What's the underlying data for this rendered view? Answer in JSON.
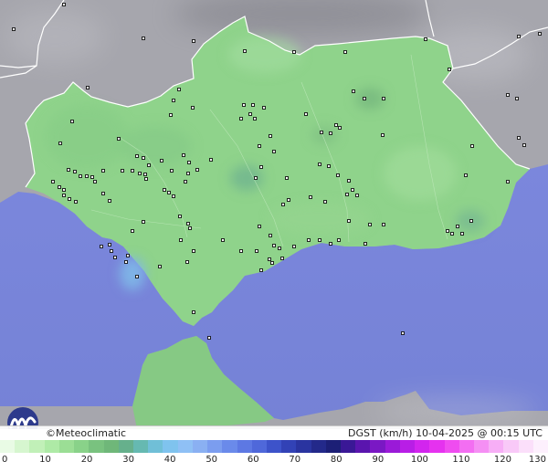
{
  "brand": {
    "text": "©Meteoclimatic"
  },
  "map_caption": {
    "variable": "DGST",
    "unit": "(km/h)",
    "timestamp": "10-04-2025 @ 00:15 UTC"
  },
  "colors": {
    "sea": "#7b87dc",
    "land_foreign": "#a6a6ad",
    "land_andalusia": "#8ed18a",
    "border": "#ffffff",
    "station": "#111111"
  },
  "scale": {
    "labels": [
      "0",
      "10",
      "20",
      "30",
      "40",
      "50",
      "60",
      "70",
      "80",
      "90",
      "100",
      "110",
      "120",
      "130"
    ],
    "colors": [
      "#e9fbe5",
      "#d6f6cf",
      "#c1f0b8",
      "#aeeaa6",
      "#9bde95",
      "#89d289",
      "#79c27f",
      "#6fb779",
      "#66b08c",
      "#66b9b1",
      "#70bfd7",
      "#7fc3ee",
      "#8fc0f5",
      "#8ab0f2",
      "#7b9def",
      "#6a8aea",
      "#5d78e3",
      "#4f68da",
      "#3d53ca",
      "#3242b6",
      "#2a34a0",
      "#23298a",
      "#1c1f76",
      "#3a1896",
      "#5a15ae",
      "#7a18c4",
      "#9a1ad8",
      "#b81ee6",
      "#d225ee",
      "#e532ef",
      "#ef4cf0",
      "#f36ef2",
      "#f58ff4",
      "#f7aef6",
      "#f9c9f8",
      "#fbdffa",
      "#fdf0fd"
    ]
  },
  "stations": [
    [
      70,
      5
    ],
    [
      15,
      32
    ],
    [
      157,
      42
    ],
    [
      212,
      45
    ],
    [
      268,
      56
    ],
    [
      322,
      57
    ],
    [
      378,
      57
    ],
    [
      466,
      43
    ],
    [
      568,
      40
    ],
    [
      591,
      37
    ],
    [
      492,
      76
    ],
    [
      96,
      96
    ],
    [
      196,
      98
    ],
    [
      267,
      115
    ],
    [
      277,
      115
    ],
    [
      289,
      118
    ],
    [
      274,
      125
    ],
    [
      264,
      130
    ],
    [
      279,
      130
    ],
    [
      211,
      118
    ],
    [
      190,
      110
    ],
    [
      187,
      126
    ],
    [
      335,
      125
    ],
    [
      387,
      100
    ],
    [
      399,
      108
    ],
    [
      420,
      108
    ],
    [
      368,
      137
    ],
    [
      372,
      140
    ],
    [
      362,
      146
    ],
    [
      352,
      145
    ],
    [
      419,
      148
    ],
    [
      556,
      104
    ],
    [
      566,
      108
    ],
    [
      568,
      151
    ],
    [
      574,
      159
    ],
    [
      517,
      160
    ],
    [
      79,
      133
    ],
    [
      130,
      152
    ],
    [
      150,
      171
    ],
    [
      157,
      173
    ],
    [
      163,
      181
    ],
    [
      145,
      187
    ],
    [
      153,
      190
    ],
    [
      159,
      191
    ],
    [
      177,
      176
    ],
    [
      188,
      187
    ],
    [
      66,
      157
    ],
    [
      75,
      186
    ],
    [
      82,
      188
    ],
    [
      88,
      193
    ],
    [
      95,
      193
    ],
    [
      101,
      194
    ],
    [
      104,
      199
    ],
    [
      113,
      187
    ],
    [
      134,
      187
    ],
    [
      160,
      196
    ],
    [
      201,
      170
    ],
    [
      207,
      178
    ],
    [
      206,
      190
    ],
    [
      203,
      199
    ],
    [
      216,
      186
    ],
    [
      231,
      175
    ],
    [
      296,
      149
    ],
    [
      284,
      160
    ],
    [
      300,
      166
    ],
    [
      286,
      183
    ],
    [
      280,
      195
    ],
    [
      314,
      195
    ],
    [
      316,
      219
    ],
    [
      310,
      224
    ],
    [
      350,
      180
    ],
    [
      360,
      182
    ],
    [
      370,
      192
    ],
    [
      382,
      198
    ],
    [
      386,
      208
    ],
    [
      391,
      214
    ],
    [
      380,
      213
    ],
    [
      356,
      221
    ],
    [
      340,
      216
    ],
    [
      180,
      208
    ],
    [
      185,
      211
    ],
    [
      190,
      215
    ],
    [
      113,
      212
    ],
    [
      120,
      220
    ],
    [
      58,
      199
    ],
    [
      65,
      205
    ],
    [
      70,
      208
    ],
    [
      70,
      214
    ],
    [
      76,
      218
    ],
    [
      83,
      221
    ],
    [
      157,
      243
    ],
    [
      197,
      237
    ],
    [
      206,
      245
    ],
    [
      208,
      250
    ],
    [
      284,
      248
    ],
    [
      296,
      258
    ],
    [
      300,
      269
    ],
    [
      306,
      272
    ],
    [
      322,
      270
    ],
    [
      338,
      263
    ],
    [
      350,
      263
    ],
    [
      362,
      267
    ],
    [
      371,
      263
    ],
    [
      382,
      242
    ],
    [
      405,
      246
    ],
    [
      420,
      246
    ],
    [
      400,
      267
    ],
    [
      490,
      253
    ],
    [
      495,
      256
    ],
    [
      501,
      248
    ],
    [
      506,
      256
    ],
    [
      516,
      242
    ],
    [
      510,
      192
    ],
    [
      556,
      199
    ],
    [
      244,
      263
    ],
    [
      264,
      275
    ],
    [
      281,
      275
    ],
    [
      295,
      284
    ],
    [
      286,
      296
    ],
    [
      298,
      288
    ],
    [
      309,
      283
    ],
    [
      120,
      268
    ],
    [
      122,
      275
    ],
    [
      126,
      282
    ],
    [
      140,
      280
    ],
    [
      150,
      303
    ],
    [
      175,
      292
    ],
    [
      205,
      287
    ],
    [
      212,
      275
    ],
    [
      198,
      263
    ],
    [
      145,
      253
    ],
    [
      111,
      270
    ],
    [
      138,
      287
    ],
    [
      212,
      342
    ],
    [
      229,
      370
    ],
    [
      441,
      365
    ]
  ]
}
